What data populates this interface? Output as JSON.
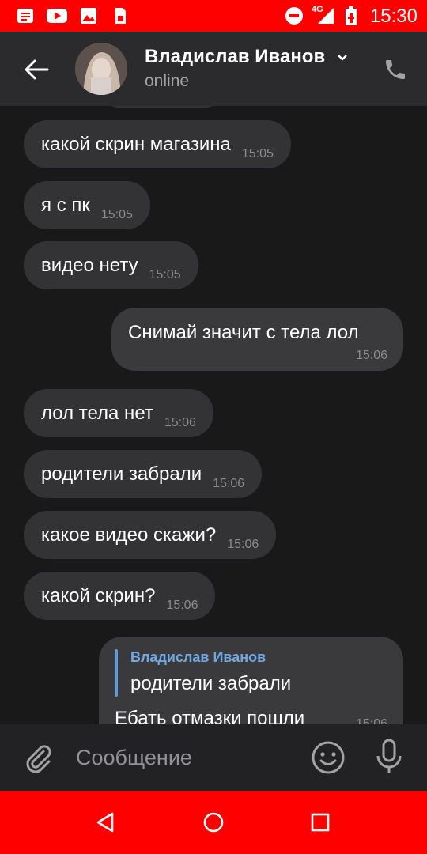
{
  "status_bar": {
    "time": "15:30",
    "network": "4G",
    "icons": [
      "notification-news-icon",
      "youtube-icon",
      "gallery-icon",
      "sim-icon",
      "dnd-icon",
      "signal-icon",
      "battery-icon"
    ]
  },
  "header": {
    "name": "Владислав Иванов",
    "status": "online"
  },
  "messages": [
    {
      "text": "какой скрин магазина",
      "time": "15:05",
      "dir": "in"
    },
    {
      "text": "я с пк",
      "time": "15:05",
      "dir": "in"
    },
    {
      "text": "видео нету",
      "time": "15:05",
      "dir": "in"
    },
    {
      "text": "Снимай значит с тела лол",
      "time": "15:06",
      "dir": "out"
    },
    {
      "text": "лол тела нет",
      "time": "15:06",
      "dir": "in"
    },
    {
      "text": "родители забрали",
      "time": "15:06",
      "dir": "in"
    },
    {
      "text": "какое видео скажи?",
      "time": "15:06",
      "dir": "in"
    },
    {
      "text": "какой скрин?",
      "time": "15:06",
      "dir": "in"
    },
    {
      "reply_to": {
        "name": "Владислав Иванов",
        "text": "родители забрали"
      },
      "text": "Ебать отмазки пошли",
      "time": "15:06",
      "dir": "out"
    }
  ],
  "composer": {
    "placeholder": "Сообщение"
  },
  "colors": {
    "system_bars": "#ff0000",
    "background": "#19191a",
    "bubble": "#333335",
    "accent": "#71a8e4"
  }
}
